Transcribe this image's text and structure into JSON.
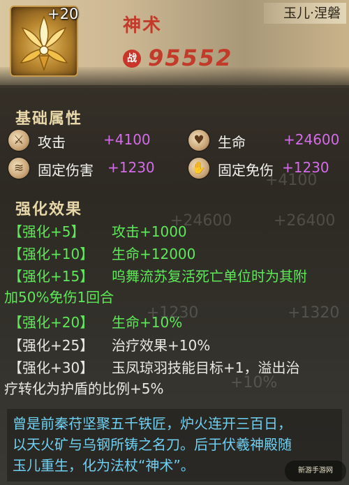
{
  "item": {
    "level": "+20",
    "name": "神术",
    "power_icon": "战",
    "power": "95552",
    "owner": "玉儿·涅磐"
  },
  "base_stats": {
    "title": "基础属性",
    "stats": [
      {
        "icon": "sword-icon",
        "glyph": "⚔",
        "label": "攻击",
        "value": "+4100"
      },
      {
        "icon": "heart-icon",
        "glyph": "♥",
        "label": "生命",
        "value": "+24600"
      },
      {
        "icon": "claw-icon",
        "glyph": "≋",
        "label": "固定伤害",
        "value": "+1230"
      },
      {
        "icon": "palm-icon",
        "glyph": "✋",
        "label": "固定免伤",
        "value": "+1230"
      }
    ]
  },
  "enhance": {
    "title": "强化效果",
    "rows": [
      {
        "tag": "【强化+5】",
        "desc": "攻击+1000",
        "active": true
      },
      {
        "tag": "【强化+10】",
        "desc": "生命+12000",
        "active": true
      },
      {
        "tag": "【强化+15】",
        "desc": "呜舞流苏复活死亡单位时为其附",
        "cont": "加50%免伤1回合",
        "active": true
      },
      {
        "tag": "【强化+20】",
        "desc": "生命+10%",
        "active": true
      },
      {
        "tag": "【强化+25】",
        "desc": "治疗效果+10%",
        "active": false
      },
      {
        "tag": "【强化+30】",
        "desc": "玉凤琼羽技能目标+1，溢出治",
        "cont": "疗转化为护盾的比例+5%",
        "active": false
      }
    ]
  },
  "lore": {
    "lines": [
      "曾是前秦苻坚聚五千铁匠，炉火连开三百日，",
      "以天火矿与乌钢所铸之名刀。后于伏羲神殿随",
      "玉儿重生，化为法杖“神术”。"
    ]
  },
  "background_ghost": [
    "+4100",
    "+24600",
    "+26400",
    "+1230",
    "+1320",
    "+10%"
  ],
  "watermark": "新游手游网",
  "colors": {
    "active": "#5ee85a",
    "inactive": "#e8e8e4",
    "stat_value": "#d36ce8",
    "lore": "#6fd0f2",
    "name_red": "#c23a2a"
  }
}
